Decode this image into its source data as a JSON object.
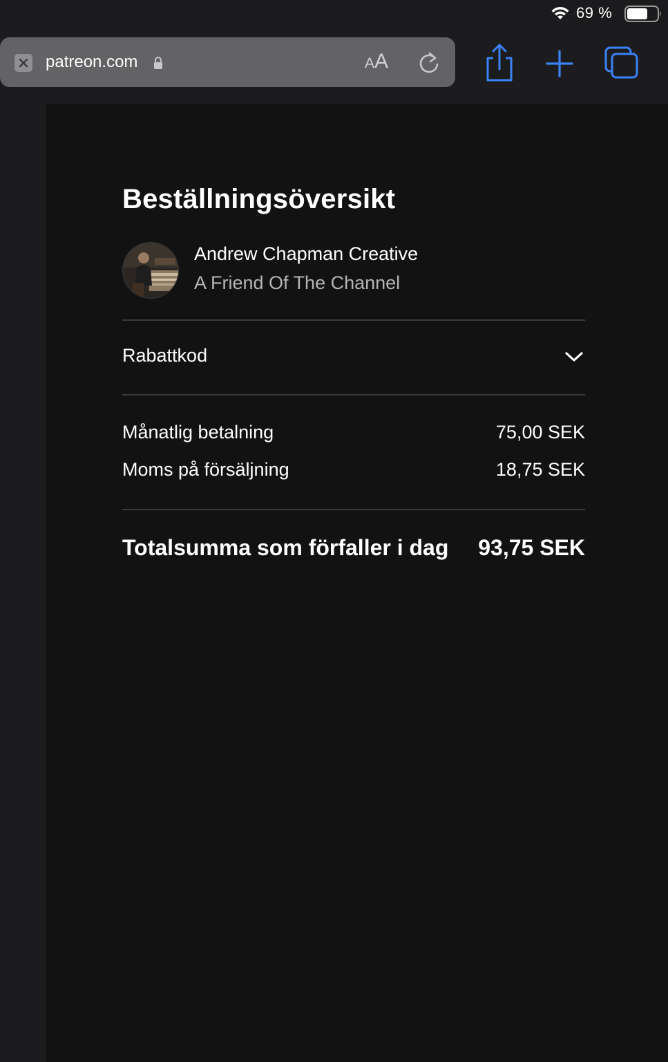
{
  "status_bar": {
    "battery_percent": "69 %",
    "battery_level": 0.69,
    "icons": [
      "wifi-icon",
      "battery-icon"
    ]
  },
  "browser": {
    "url": "patreon.com",
    "text_size_label_small": "A",
    "text_size_label_big": "A",
    "icons": [
      "close-icon",
      "lock-icon",
      "reload-icon",
      "share-icon",
      "plus-icon",
      "tabs-icon"
    ],
    "accent_color": "#3a82f7"
  },
  "order_summary": {
    "title": "Beställningsöversikt",
    "creator_name": "Andrew Chapman Creative",
    "tier_name": "A Friend Of The Channel",
    "discount_label": "Rabattkod",
    "line_items": [
      {
        "label": "Månatlig betalning",
        "value": "75,00 SEK"
      },
      {
        "label": "Moms på försäljning",
        "value": "18,75 SEK"
      }
    ],
    "total": {
      "label": "Totalsumma som förfaller i dag",
      "value": "93,75 SEK"
    }
  }
}
